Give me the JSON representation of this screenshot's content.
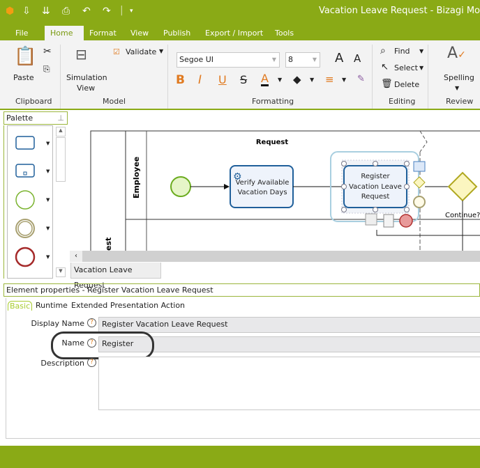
{
  "window": {
    "title": "Vacation Leave Request - Bizagi Mo",
    "brand_color": "#8aaa16"
  },
  "quick_access": [
    {
      "icon": "bizagi-logo-icon"
    },
    {
      "icon": "save-icon"
    },
    {
      "icon": "save-as-icon"
    },
    {
      "icon": "print-icon"
    },
    {
      "icon": "undo-icon"
    },
    {
      "icon": "redo-icon"
    },
    {
      "icon": "customize-icon"
    }
  ],
  "ribbon_tabs": [
    "File",
    "Home",
    "Format",
    "View",
    "Publish",
    "Export / Import",
    "Tools"
  ],
  "ribbon": {
    "clipboard": {
      "label": "Clipboard",
      "paste": "Paste"
    },
    "model": {
      "label": "Model",
      "simulation": "Simulation",
      "simulation2": "View",
      "validate": "Validate"
    },
    "formatting": {
      "label": "Formatting",
      "font": "Segoe UI",
      "size": "8"
    },
    "editing": {
      "label": "Editing",
      "find": "Find",
      "select": "Select",
      "delete": "Delete"
    },
    "review": {
      "label": "Review",
      "spelling": "Spelling"
    }
  },
  "palette": {
    "title": "Palette"
  },
  "diagram": {
    "phase": "Request",
    "lane1": "Employee",
    "lane2": "est",
    "task1": [
      "Verify Available",
      "Vacation Days"
    ],
    "task2": [
      "Register",
      "Vacation Leave",
      "Request"
    ],
    "gateway": "Continue?"
  },
  "doc_tab": "Vacation Leave Request",
  "properties": {
    "header": "Element properties - Register Vacation Leave Request",
    "tabs": [
      "Basic",
      "Runtime",
      "Extended",
      "Presentation Action"
    ],
    "display_name_label": "Display Name",
    "display_name": "Register Vacation Leave Request",
    "name_label": "Name",
    "name": "Register",
    "description_label": "Description",
    "description": "",
    "help": "?"
  }
}
